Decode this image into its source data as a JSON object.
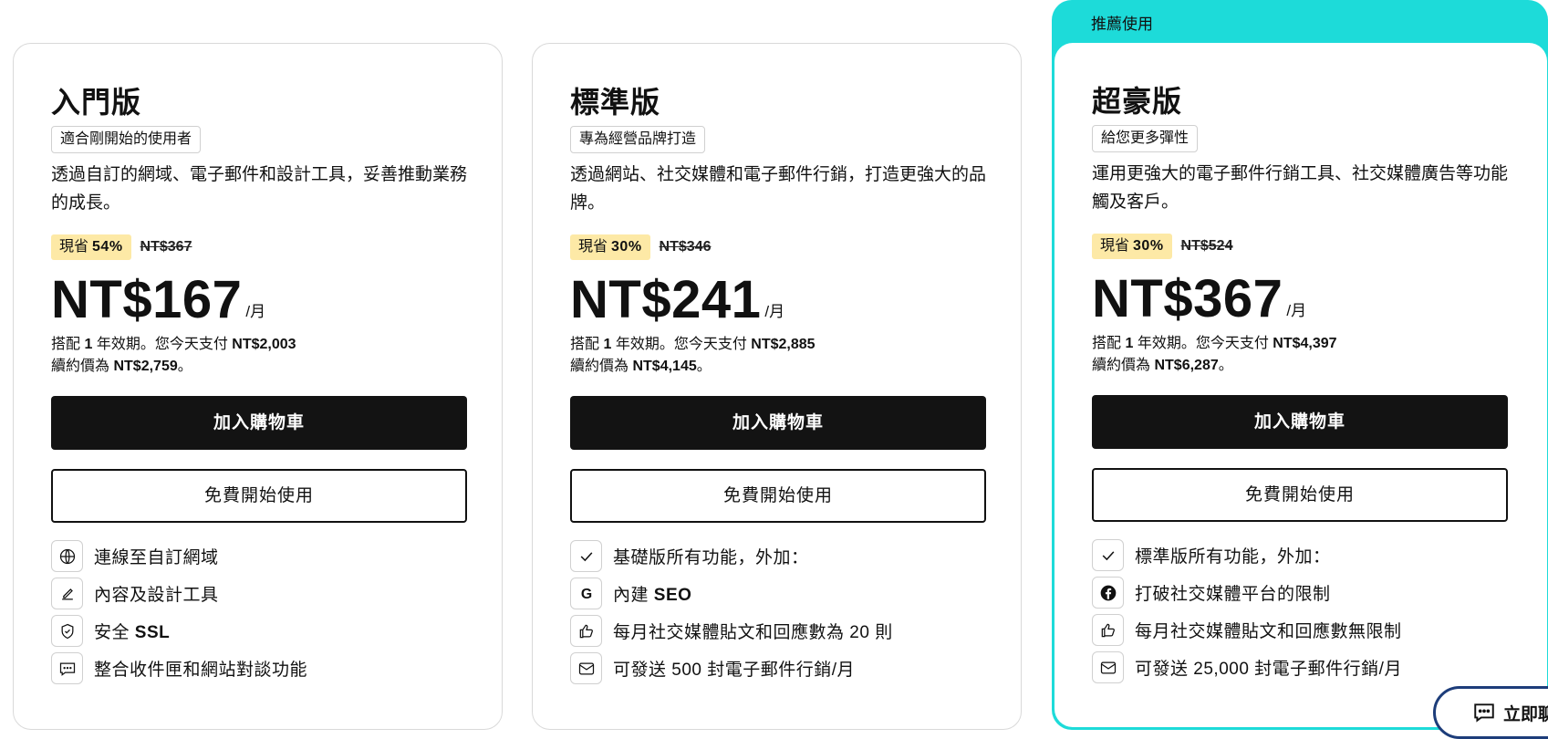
{
  "recommended_label": "推薦使用",
  "plans": [
    {
      "name": "入門版",
      "tagline": "適合剛開始的使用者",
      "description": "透過自訂的網域、電子郵件和設計工具，妥善推動業務的成長。",
      "save_prefix": "現省",
      "save_percent": "54%",
      "original_price": "NT$367",
      "price": "NT$167",
      "per": "/月",
      "term_prefix": "搭配",
      "term_years": "1",
      "term_mid": "年效期。您今天支付",
      "today_pay": "NT$2,003",
      "renew_prefix": "續約價為",
      "renew_price": "NT$2,759",
      "renew_suffix": "。",
      "cart_label": "加入購物車",
      "free_label": "免費開始使用",
      "features": [
        {
          "icon": "globe-icon",
          "text": "連線至自訂網域",
          "bold": ""
        },
        {
          "icon": "pen-icon",
          "text": "內容及設計工具",
          "bold": ""
        },
        {
          "icon": "shield-icon",
          "text": "安全",
          "bold": "SSL"
        },
        {
          "icon": "chat-icon",
          "text": "整合收件匣和網站對談功能",
          "bold": ""
        }
      ]
    },
    {
      "name": "標準版",
      "tagline": "專為經營品牌打造",
      "description": "透過網站、社交媒體和電子郵件行銷，打造更強大的品牌。",
      "save_prefix": "現省",
      "save_percent": "30%",
      "original_price": "NT$346",
      "price": "NT$241",
      "per": "/月",
      "term_prefix": "搭配",
      "term_years": "1",
      "term_mid": "年效期。您今天支付",
      "today_pay": "NT$2,885",
      "renew_prefix": "續約價為",
      "renew_price": "NT$4,145",
      "renew_suffix": "。",
      "cart_label": "加入購物車",
      "free_label": "免費開始使用",
      "features": [
        {
          "icon": "check-icon",
          "text": "基礎版所有功能，外加：",
          "bold": ""
        },
        {
          "icon": "google-icon",
          "text": "內建",
          "bold": "SEO"
        },
        {
          "icon": "thumbs-up-icon",
          "text": "每月社交媒體貼文和回應數為 20 則",
          "bold": ""
        },
        {
          "icon": "mail-icon",
          "text": "可發送 500 封電子郵件行銷/月",
          "bold": ""
        }
      ]
    },
    {
      "name": "超豪版",
      "tagline": "給您更多彈性",
      "description": "運用更強大的電子郵件行銷工具、社交媒體廣告等功能觸及客戶。",
      "save_prefix": "現省",
      "save_percent": "30%",
      "original_price": "NT$524",
      "price": "NT$367",
      "per": "/月",
      "term_prefix": "搭配",
      "term_years": "1",
      "term_mid": "年效期。您今天支付",
      "today_pay": "NT$4,397",
      "renew_prefix": "續約價為",
      "renew_price": "NT$6,287",
      "renew_suffix": "。",
      "cart_label": "加入購物車",
      "free_label": "免費開始使用",
      "features": [
        {
          "icon": "check-icon",
          "text": "標準版所有功能，外加：",
          "bold": ""
        },
        {
          "icon": "facebook-icon",
          "text": "打破社交媒體平台的限制",
          "bold": ""
        },
        {
          "icon": "thumbs-up-icon",
          "text": "每月社交媒體貼文和回應數無限制",
          "bold": ""
        },
        {
          "icon": "mail-icon",
          "text": "可發送 25,000 封電子郵件行銷/月",
          "bold": ""
        }
      ]
    }
  ],
  "chat_button_label": "立即聊"
}
